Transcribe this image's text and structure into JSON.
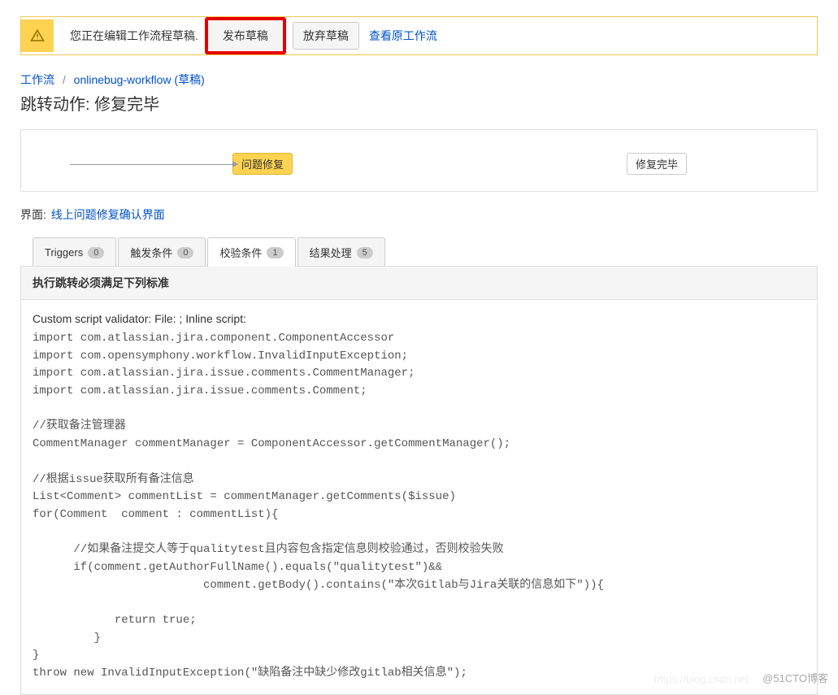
{
  "alert": {
    "text": "您正在编辑工作流程草稿.",
    "publish_btn": "发布草稿",
    "discard_btn": "放弃草稿",
    "view_original_link": "查看原工作流"
  },
  "breadcrumb": {
    "root": "工作流",
    "workflow_name": "onlinebug-workflow (草稿)"
  },
  "page_title": "跳转动作: 修复完毕",
  "flow": {
    "from_status": "问题修复",
    "to_status": "修复完毕"
  },
  "screen": {
    "label": "界面:",
    "value": "线上问题修复确认界面"
  },
  "tabs": [
    {
      "label": "Triggers",
      "count": "0",
      "active": false
    },
    {
      "label": "触发条件",
      "count": "0",
      "active": false
    },
    {
      "label": "校验条件",
      "count": "1",
      "active": true
    },
    {
      "label": "结果处理",
      "count": "5",
      "active": false
    }
  ],
  "section": {
    "header": "执行跳转必须满足下列标准",
    "script_title": "Custom script validator: File: ; Inline script:",
    "code": "import com.atlassian.jira.component.ComponentAccessor\nimport com.opensymphony.workflow.InvalidInputException;\nimport com.atlassian.jira.issue.comments.CommentManager;\nimport com.atlassian.jira.issue.comments.Comment;\n\n//获取备注管理器\nCommentManager commentManager = ComponentAccessor.getCommentManager();\n\n//根据issue获取所有备注信息\nList<Comment> commentList = commentManager.getComments($issue)\nfor(Comment  comment : commentList){\n\n      //如果备注提交人等于qualitytest且内容包含指定信息则校验通过，否则校验失败\n      if(comment.getAuthorFullName().equals(\"qualitytest\")&&\n                         comment.getBody().contains(\"本次Gitlab与Jira关联的信息如下\")){\n\n            return true;\n         }\n}\nthrow new InvalidInputException(\"缺陷备注中缺少修改gitlab相关信息\");"
  },
  "watermark": "@51CTO博客",
  "watermark_faint": "https://blog.csdn.net"
}
